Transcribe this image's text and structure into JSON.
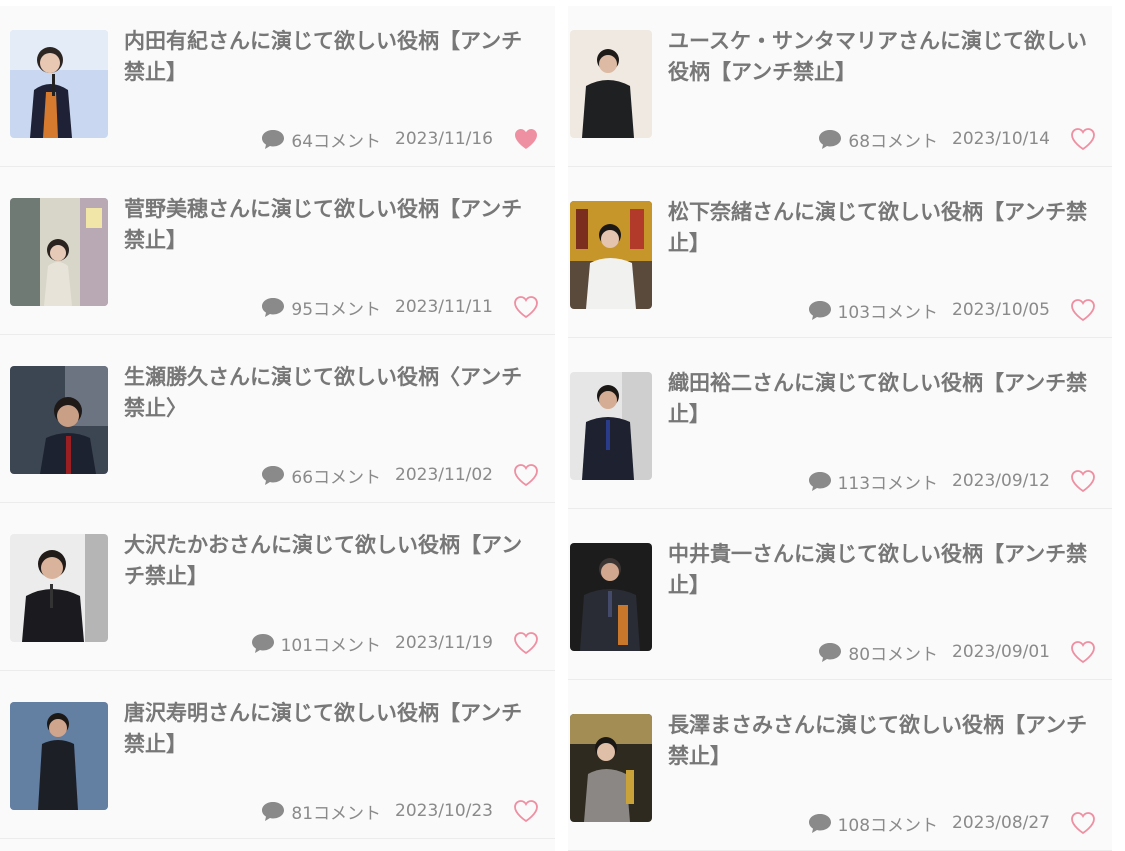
{
  "colors": {
    "title": "#777777",
    "meta": "#8a8a8a",
    "heart_outline": "#ef8fa2",
    "heart_filled": "#ef8fa2",
    "card_bg": "#fafafa"
  },
  "left": [
    {
      "title": "内田有紀さんに演じて欲しい役柄【アンチ禁止】",
      "comments": "64コメント",
      "date": "2023/11/16",
      "liked": true,
      "heart_icon": "heart-filled"
    },
    {
      "title": "菅野美穂さんに演じて欲しい役柄【アンチ禁止】",
      "comments": "95コメント",
      "date": "2023/11/11",
      "liked": false,
      "heart_icon": "heart-outline"
    },
    {
      "title": "生瀬勝久さんに演じて欲しい役柄〈アンチ禁止〉",
      "comments": "66コメント",
      "date": "2023/11/02",
      "liked": false,
      "heart_icon": "heart-outline"
    },
    {
      "title": "大沢たかおさんに演じて欲しい役柄【アンチ禁止】",
      "comments": "101コメント",
      "date": "2023/11/19",
      "liked": false,
      "heart_icon": "heart-outline"
    },
    {
      "title": "唐沢寿明さんに演じて欲しい役柄【アンチ禁止】",
      "comments": "81コメント",
      "date": "2023/10/23",
      "liked": false,
      "heart_icon": "heart-outline"
    }
  ],
  "right": [
    {
      "title": "ユースケ・サンタマリアさんに演じて欲しい役柄【アンチ禁止】",
      "comments": "68コメント",
      "date": "2023/10/14",
      "liked": false,
      "heart_icon": "heart-outline"
    },
    {
      "title": "松下奈緒さんに演じて欲しい役柄【アンチ禁止】",
      "comments": "103コメント",
      "date": "2023/10/05",
      "liked": false,
      "heart_icon": "heart-outline"
    },
    {
      "title": "織田裕二さんに演じて欲しい役柄【アンチ禁止】",
      "comments": "113コメント",
      "date": "2023/09/12",
      "liked": false,
      "heart_icon": "heart-outline"
    },
    {
      "title": "中井貴一さんに演じて欲しい役柄【アンチ禁止】",
      "comments": "80コメント",
      "date": "2023/09/01",
      "liked": false,
      "heart_icon": "heart-outline"
    },
    {
      "title": "長澤まさみさんに演じて欲しい役柄【アンチ禁止】",
      "comments": "108コメント",
      "date": "2023/08/27",
      "liked": false,
      "heart_icon": "heart-outline"
    }
  ]
}
